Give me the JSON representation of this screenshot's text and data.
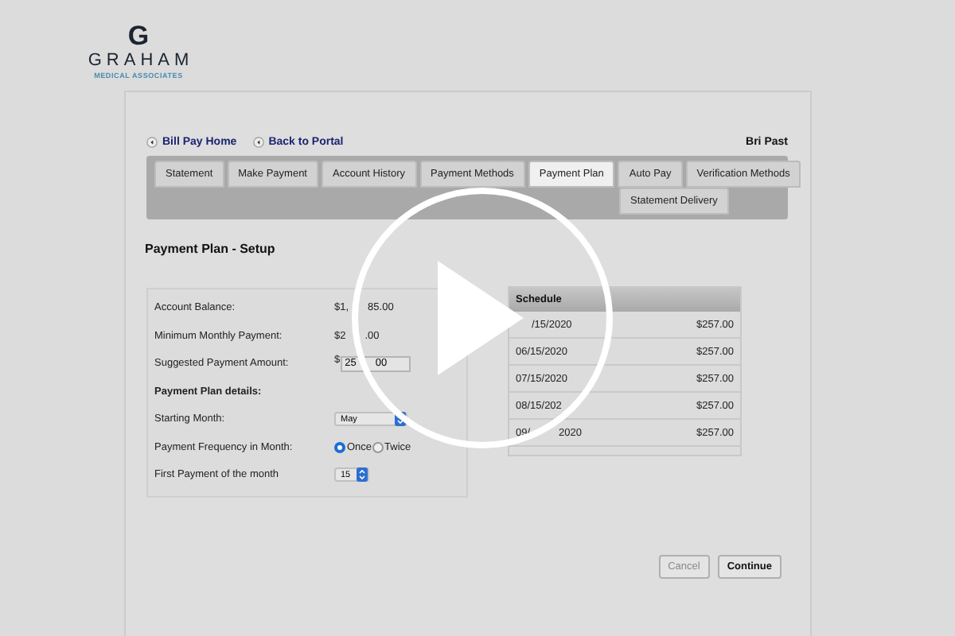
{
  "logo": {
    "mark": "G",
    "name": "GRAHAM",
    "tagline": "MEDICAL ASSOCIATES"
  },
  "nav_links": [
    "Bill Pay Home",
    "Back to Portal"
  ],
  "user": "Bri Past",
  "tabs": [
    {
      "label": "Statement",
      "selected": false
    },
    {
      "label": "Make Payment",
      "selected": false
    },
    {
      "label": "Account History",
      "selected": false
    },
    {
      "label": "Payment Methods",
      "selected": false
    },
    {
      "label": "Payment Plan",
      "selected": true
    },
    {
      "label": "Auto Pay",
      "selected": false
    },
    {
      "label": "Verification Methods",
      "selected": false
    }
  ],
  "sub_tabs": [
    {
      "label": "Statement Delivery",
      "selected": false
    }
  ],
  "title": "Payment Plan - Setup",
  "form": [
    {
      "kind": "text",
      "label": "Account Balance:",
      "value_head": "$1,",
      "value_tail": "85.00"
    },
    {
      "kind": "text",
      "label": "Minimum Monthly Payment:",
      "value_head": "$2",
      "value_tail": ".00"
    },
    {
      "kind": "input",
      "label": "Suggested Payment Amount:",
      "prefix": "$",
      "value_head": "25",
      "value_tail": "00"
    },
    {
      "kind": "heading",
      "label": "Payment Plan details:"
    },
    {
      "kind": "select",
      "label": "Starting Month:",
      "value": "May"
    },
    {
      "kind": "radio",
      "label": "Payment Frequency in Month:",
      "options": [
        {
          "label": "Once",
          "selected": true
        },
        {
          "label": "Twice",
          "selected": false
        }
      ]
    },
    {
      "kind": "select",
      "label": "First Payment of the month",
      "value": "15"
    }
  ],
  "schedule": {
    "header": "Schedule",
    "rows": [
      {
        "date": "/15/2020",
        "amount": "$257.00"
      },
      {
        "date": "06/15/2020",
        "amount": "$257.00"
      },
      {
        "date": "07/15/2020",
        "amount": "$257.00"
      },
      {
        "date": "08/15/202",
        "amount": "$257.00"
      },
      {
        "date": "09/",
        "date_tail": "2020",
        "amount": "$257.00"
      }
    ]
  },
  "buttons": [
    {
      "label": "Cancel",
      "disabled": true
    },
    {
      "label": "Continue",
      "disabled": false
    }
  ],
  "video": {
    "kind": "play-overlay"
  }
}
